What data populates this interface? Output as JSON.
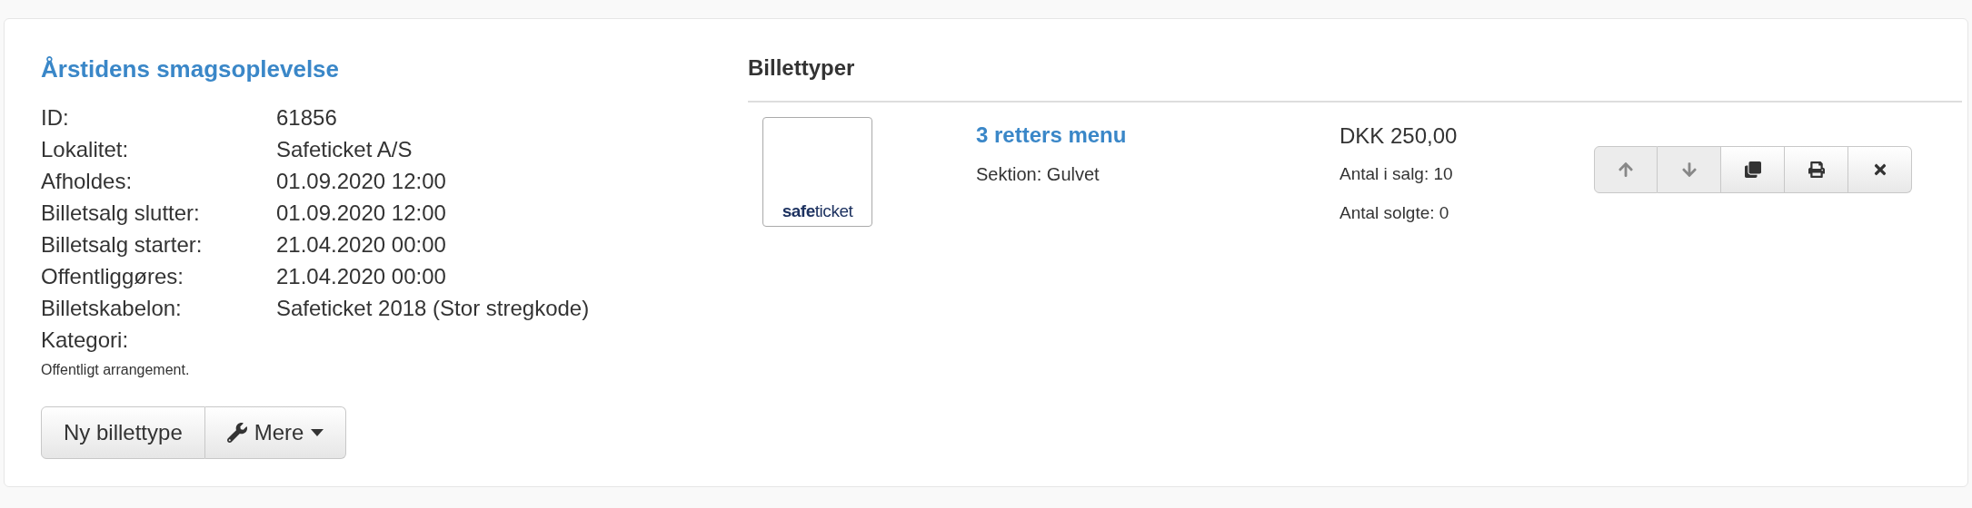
{
  "event": {
    "title": "Årstidens smagsoplevelse",
    "details": [
      {
        "label": "ID:",
        "value": "61856"
      },
      {
        "label": "Lokalitet:",
        "value": "Safeticket A/S"
      },
      {
        "label": "Afholdes:",
        "value": "01.09.2020 12:00"
      },
      {
        "label": "Billetsalg slutter:",
        "value": "01.09.2020 12:00"
      },
      {
        "label": "Billetsalg starter:",
        "value": "21.04.2020 00:00"
      },
      {
        "label": "Offentliggøres:",
        "value": "21.04.2020 00:00"
      },
      {
        "label": "Billetskabelon:",
        "value": "Safeticket 2018 (Stor stregkode)"
      },
      {
        "label": "Kategori:"
      }
    ],
    "note": "Offentligt arrangement.",
    "buttons": [
      {
        "kind": "plain",
        "label": "Ny billettype"
      },
      {
        "kind": "dropdown",
        "label": "Mere"
      }
    ]
  },
  "ticket_types": {
    "heading": "Billettyper",
    "items": [
      {
        "logo": "**safe**ticket",
        "name": "3 retters menu",
        "section": "Sektion: Gulvet",
        "price": "DKK 250,00",
        "in_sale": "Antal i salg: 10",
        "sold": "Antal solgte: 0",
        "actions": [
          {
            "kind": "up",
            "disabled": true
          },
          {
            "kind": "down",
            "disabled": true
          },
          {
            "kind": "copy",
            "disabled": false
          },
          {
            "kind": "print",
            "disabled": false
          },
          {
            "kind": "delete",
            "disabled": false
          }
        ]
      }
    ]
  }
}
